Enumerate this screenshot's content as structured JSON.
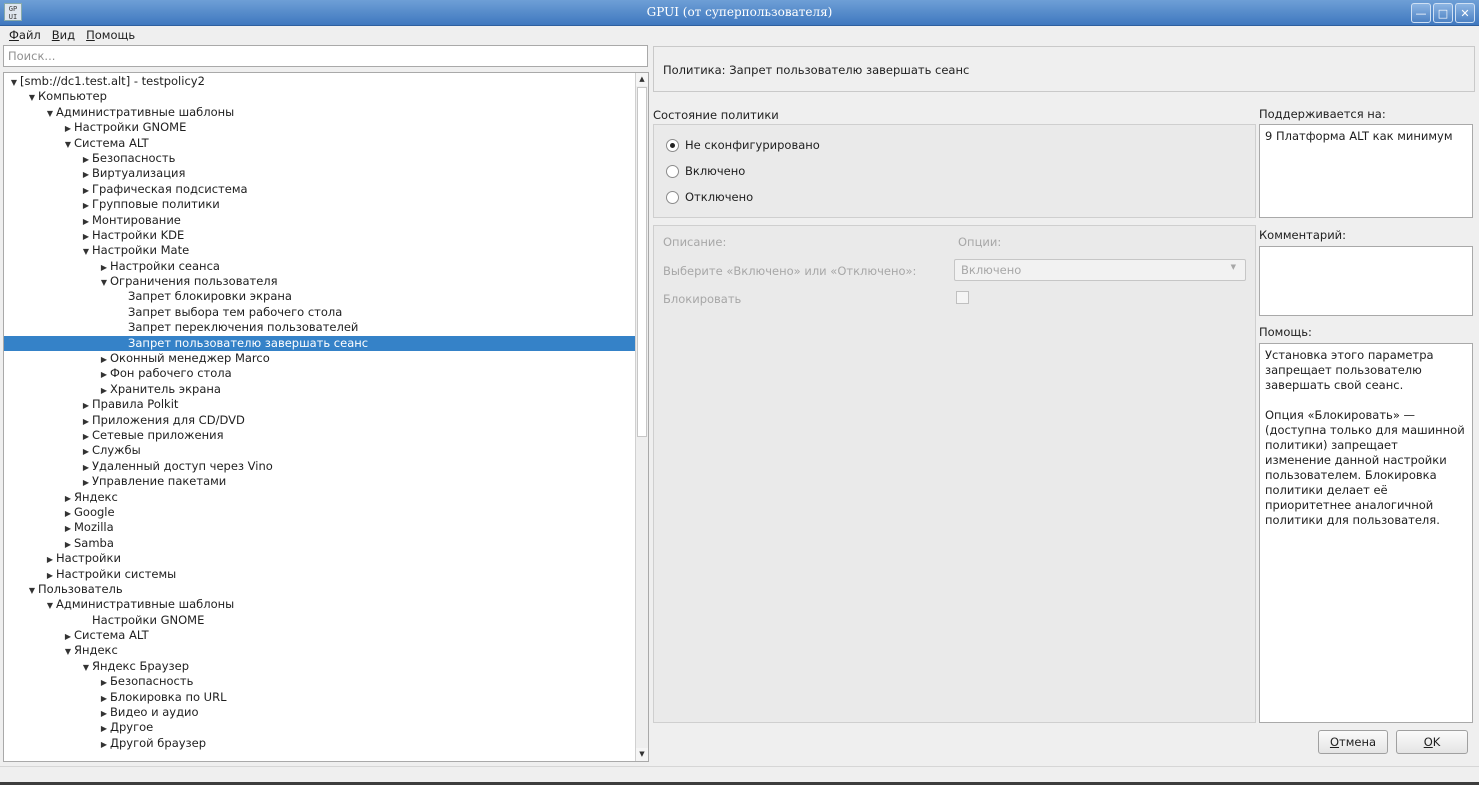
{
  "window": {
    "icon_text": "GP\nUI",
    "title": "GPUI (от суперпользователя)",
    "controls": [
      "minimize",
      "maximize",
      "close"
    ]
  },
  "menubar": {
    "items": [
      "Файл",
      "Вид",
      "Помощь"
    ]
  },
  "search": {
    "placeholder": "Поиск..."
  },
  "tree": {
    "selected_index": 17,
    "rows": [
      {
        "label": "[smb://dc1.test.alt] - testpolicy2",
        "level": 0,
        "state": "expanded"
      },
      {
        "label": "Компьютер",
        "level": 1,
        "state": "expanded"
      },
      {
        "label": "Административные шаблоны",
        "level": 2,
        "state": "expanded"
      },
      {
        "label": "Настройки GNOME",
        "level": 3,
        "state": "collapsed"
      },
      {
        "label": "Система ALT",
        "level": 3,
        "state": "expanded"
      },
      {
        "label": "Безопасность",
        "level": 4,
        "state": "collapsed"
      },
      {
        "label": "Виртуализация",
        "level": 4,
        "state": "collapsed"
      },
      {
        "label": "Графическая подсистема",
        "level": 4,
        "state": "collapsed"
      },
      {
        "label": "Групповые политики",
        "level": 4,
        "state": "collapsed"
      },
      {
        "label": "Монтирование",
        "level": 4,
        "state": "collapsed"
      },
      {
        "label": "Настройки KDE",
        "level": 4,
        "state": "collapsed"
      },
      {
        "label": "Настройки Mate",
        "level": 4,
        "state": "expanded"
      },
      {
        "label": "Настройки сеанса",
        "level": 5,
        "state": "collapsed"
      },
      {
        "label": "Ограничения пользователя",
        "level": 5,
        "state": "expanded"
      },
      {
        "label": "Запрет блокировки экрана",
        "level": 6,
        "state": "leaf"
      },
      {
        "label": "Запрет выбора тем рабочего стола",
        "level": 6,
        "state": "leaf"
      },
      {
        "label": "Запрет переключения пользователей",
        "level": 6,
        "state": "leaf"
      },
      {
        "label": "Запрет пользователю завершать сеанс",
        "level": 6,
        "state": "leaf"
      },
      {
        "label": "Оконный менеджер Marco",
        "level": 5,
        "state": "collapsed"
      },
      {
        "label": "Фон рабочего стола",
        "level": 5,
        "state": "collapsed"
      },
      {
        "label": "Хранитель экрана",
        "level": 5,
        "state": "collapsed"
      },
      {
        "label": "Правила Polkit",
        "level": 4,
        "state": "collapsed"
      },
      {
        "label": "Приложения для CD/DVD",
        "level": 4,
        "state": "collapsed"
      },
      {
        "label": "Сетевые приложения",
        "level": 4,
        "state": "collapsed"
      },
      {
        "label": "Службы",
        "level": 4,
        "state": "collapsed"
      },
      {
        "label": "Удаленный доступ через Vino",
        "level": 4,
        "state": "collapsed"
      },
      {
        "label": "Управление пакетами",
        "level": 4,
        "state": "collapsed"
      },
      {
        "label": "Яндекс",
        "level": 3,
        "state": "collapsed"
      },
      {
        "label": "Google",
        "level": 3,
        "state": "collapsed"
      },
      {
        "label": "Mozilla",
        "level": 3,
        "state": "collapsed"
      },
      {
        "label": "Samba",
        "level": 3,
        "state": "collapsed"
      },
      {
        "label": "Настройки",
        "level": 2,
        "state": "collapsed"
      },
      {
        "label": "Настройки системы",
        "level": 2,
        "state": "collapsed"
      },
      {
        "label": "Пользователь",
        "level": 1,
        "state": "expanded"
      },
      {
        "label": "Административные шаблоны",
        "level": 2,
        "state": "expanded"
      },
      {
        "label": "Настройки GNOME",
        "level": 4,
        "state": "leaf"
      },
      {
        "label": "Система ALT",
        "level": 3,
        "state": "collapsed"
      },
      {
        "label": "Яндекс",
        "level": 3,
        "state": "expanded"
      },
      {
        "label": "Яндекс Браузер",
        "level": 4,
        "state": "expanded"
      },
      {
        "label": "Безопасность",
        "level": 5,
        "state": "collapsed"
      },
      {
        "label": "Блокировка по URL",
        "level": 5,
        "state": "collapsed"
      },
      {
        "label": "Видео и аудио",
        "level": 5,
        "state": "collapsed"
      },
      {
        "label": "Другое",
        "level": 5,
        "state": "collapsed"
      },
      {
        "label": "Другой браузер",
        "level": 5,
        "state": "collapsed"
      }
    ]
  },
  "policy": {
    "header": "Политика: Запрет пользователю завершать сеанс"
  },
  "state": {
    "label": "Состояние политики",
    "options": [
      {
        "label": "Не сконфигурировано",
        "checked": true
      },
      {
        "label": "Включено",
        "checked": false
      },
      {
        "label": "Отключено",
        "checked": false
      }
    ]
  },
  "options_panel": {
    "description_label": "Описание:",
    "options_label": "Опции:",
    "choose_label": "Выберите «Включено» или «Отключено»:",
    "combo_value": "Включено",
    "lock_label": "Блокировать",
    "lock_checked": false
  },
  "supported": {
    "label": "Поддерживается на:",
    "value": "9 Платформа ALT как минимум"
  },
  "comment": {
    "label": "Комментарий:",
    "value": ""
  },
  "help": {
    "label": "Помощь:",
    "paragraphs": [
      "Установка этого параметра запрещает пользователю завершать свой сеанс.",
      "Опция «Блокировать» — (доступна только для машинной политики) запрещает изменение данной настройки пользователем. Блокировка политики делает её приоритетнее аналогичной политики для пользователя."
    ]
  },
  "buttons": {
    "cancel": "Отмена",
    "ok": "OK"
  }
}
